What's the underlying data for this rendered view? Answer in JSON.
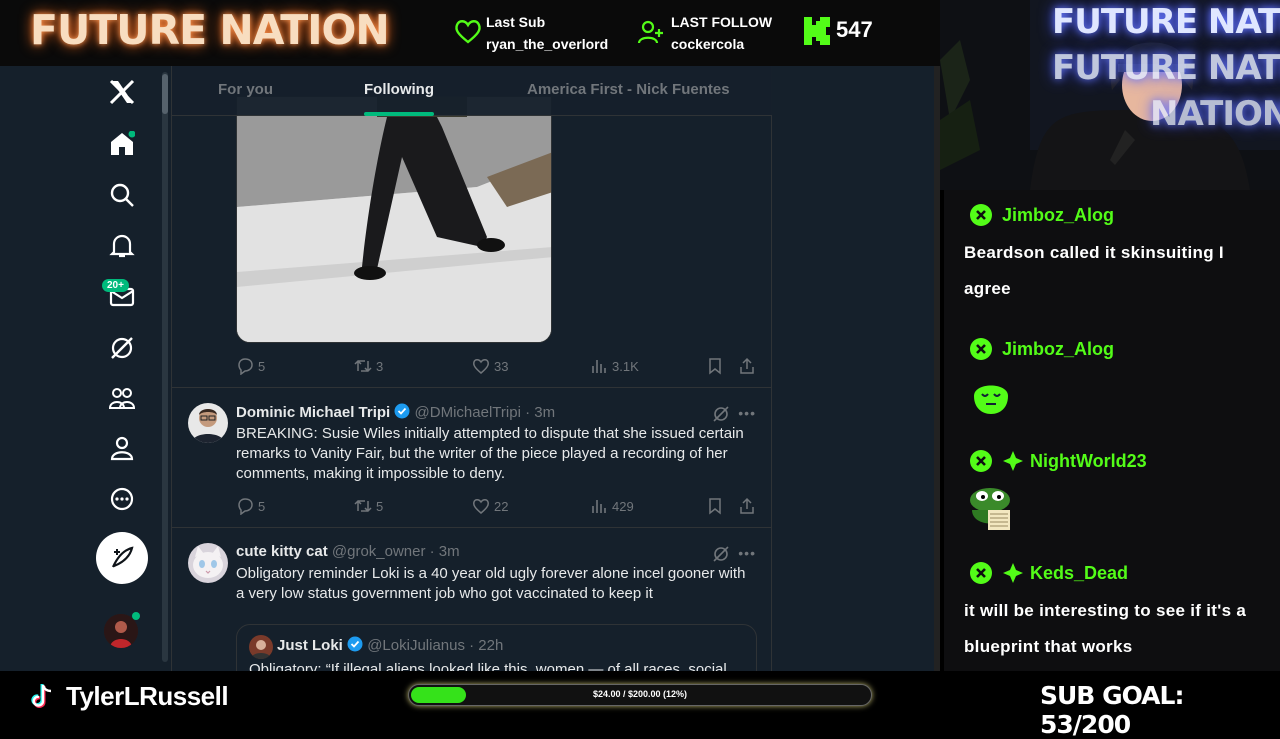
{
  "stream": {
    "logo": "FUTURE NATION",
    "last_sub_label": "Last Sub",
    "last_sub_value": "ryan_the_overlord",
    "last_follow_label": "LAST FOLLOW",
    "last_follow_value": "cockercola",
    "viewer_count": "547",
    "cam_sign": [
      "FUTURE NATION",
      "FUTURE NATION",
      "NATION"
    ],
    "username": "TylerLRussell",
    "goal_text": "$24.00 / $200.00 (12%)",
    "goal_progress_percent": 12,
    "sub_goal": "SUB GOAL: 53/200",
    "colors": {
      "kick_green": "#53fc18",
      "x_bg": "#15202b",
      "accent": "#00ba7c"
    }
  },
  "x": {
    "notification_badge": "20+",
    "nav_icons": [
      "x-logo-icon",
      "home-icon",
      "search-icon",
      "bell-icon",
      "mail-icon",
      "grok-icon",
      "communities-icon",
      "profile-icon",
      "more-icon",
      "post-icon"
    ],
    "tabs": [
      "For you",
      "Following",
      "America First - Nick Fuentes"
    ],
    "active_tab": "Following",
    "post1_actions": {
      "replies": "5",
      "reposts": "3",
      "likes": "33",
      "views": "3.1K"
    },
    "tweet2": {
      "name": "Dominic Michael Tripi",
      "handle_time": "@DMichaelTripi · 3m",
      "text": "BREAKING: Susie Wiles initially attempted to dispute that she issued certain remarks to Vanity Fair, but the writer of the piece played a recording of her comments, making it impossible to deny.",
      "replies": "5",
      "reposts": "5",
      "likes": "22",
      "views": "429"
    },
    "tweet3": {
      "name": "cute kitty cat",
      "handle_time": "@grok_owner · 3m",
      "text": "Obligatory reminder Loki is a 40 year old ugly forever alone incel gooner with a very low status government job who got vaccinated to keep it",
      "quote_name": "Just Loki",
      "quote_handle_time": "@LokiJulianus · 22h",
      "quote_text": "Obligatory: “If illegal aliens looked like this, women — of all races, social"
    }
  },
  "chat": {
    "messages": [
      {
        "user": "Jimboz_Alog",
        "text": "Beardson called it skinsuiting I agree",
        "badges": [
          "kick"
        ]
      },
      {
        "user": "Jimboz_Alog",
        "text": "",
        "badges": [
          "kick"
        ],
        "emote": "green-blob-emote"
      },
      {
        "user": "NightWorld23",
        "text": "",
        "badges": [
          "kick",
          "sub"
        ],
        "emote": "pepe-emote"
      },
      {
        "user": "Keds_Dead",
        "text": "it will be interesting to see if it's a blueprint that works",
        "badges": [
          "kick",
          "sub"
        ]
      }
    ]
  }
}
